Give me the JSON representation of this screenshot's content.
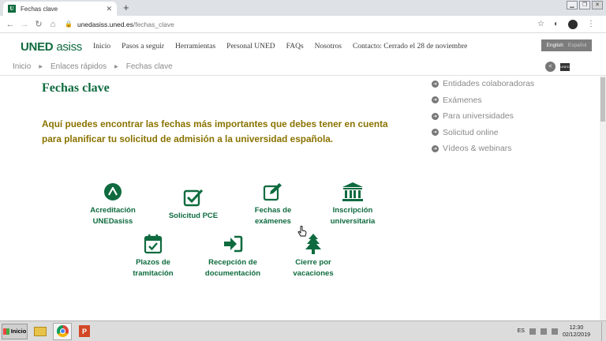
{
  "browser": {
    "tab_title": "Fechas clave",
    "tab_icon_letter": "U",
    "url_host": "unedasiss.uned.es",
    "url_path": "/fechas_clave"
  },
  "site": {
    "logo_part1": "UNED",
    "logo_part2": "asiss",
    "menu": [
      "Inicio",
      "Pasos a seguir",
      "Herramientas",
      "Personal UNED",
      "FAQs",
      "Nosotros",
      "Contacto: Cerrado el 28 de noviembre"
    ],
    "lang_en": "English",
    "lang_es": "Español",
    "print_label": "UNED"
  },
  "breadcrumb": [
    "Inicio",
    "Enlaces rápidos",
    "Fechas clave"
  ],
  "main": {
    "title": "Fechas clave",
    "intro": "Aquí puedes encontrar las fechas más importantes que debes tener en cuenta para planificar tu solicitud de admisión a la universidad española."
  },
  "sidebar": {
    "links": [
      "Entidades colaboradoras",
      "Exámenes",
      "Para universidades",
      "Solicitud online",
      "Vídeos & webinars"
    ]
  },
  "features": [
    {
      "line1": "Acreditación",
      "line2": "UNEDasiss",
      "icon": "acreditacion-icon"
    },
    {
      "line1": "Solicitud PCE",
      "line2": "",
      "icon": "checkbox-icon"
    },
    {
      "line1": "Fechas de",
      "line2": "exámenes",
      "icon": "edit-icon"
    },
    {
      "line1": "Inscripción",
      "line2": "universitaria",
      "icon": "university-icon"
    },
    {
      "line1": "Plazos de",
      "line2": "tramitación",
      "icon": "calendar-check-icon"
    },
    {
      "line1": "Recepción de",
      "line2": "documentación",
      "icon": "sign-in-icon"
    },
    {
      "line1": "Cierre por",
      "line2": "vacaciones",
      "icon": "tree-icon"
    }
  ],
  "taskbar": {
    "start_label": "Inicio",
    "lang": "ES",
    "time": "12:30",
    "date": "02/12/2019"
  },
  "colors": {
    "brand_green": "#0f6b3f",
    "intro_gold": "#8a7300"
  }
}
